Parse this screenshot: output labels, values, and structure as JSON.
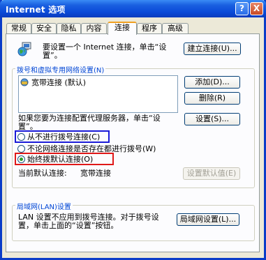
{
  "window": {
    "title": "Internet 选项",
    "help_label": "?",
    "close_label": "X"
  },
  "tabs": [
    {
      "label": "常规"
    },
    {
      "label": "安全"
    },
    {
      "label": "隐私"
    },
    {
      "label": "内容"
    },
    {
      "label": "连接",
      "active": true
    },
    {
      "label": "程序"
    },
    {
      "label": "高级"
    }
  ],
  "setup": {
    "text_line1": "要设置一个 Internet 连接，单击“设",
    "text_line2": "置”。",
    "button": "建立连接(U)..."
  },
  "dialup": {
    "group_label": "拨号和虚拟专用网络设置(N)",
    "items": [
      {
        "label": "宽带连接 (默认)"
      }
    ],
    "add_button": "添加(D)...",
    "remove_button": "删除(R)",
    "proxy_text_line1": "如果您要为连接配置代理服务器，单击“设",
    "proxy_text_line2": "置”。",
    "settings_button": "设置(S)...",
    "options": [
      {
        "label": "从不进行拨号连接(C)",
        "selected": false
      },
      {
        "label": "不论网络连接是否存在都进行拨号(W)",
        "selected": false
      },
      {
        "label": "始终拨默认连接(O)",
        "selected": true
      }
    ],
    "current_label": "当前默认连接:",
    "current_value": "宽带连接",
    "set_default_button": "设置默认值(E)"
  },
  "lan": {
    "group_label": "局域网(LAN)设置",
    "text_line1": "LAN 设置不应用到拨号连接。对于拨号设",
    "text_line2": "置，单击上面的“设置”按钮。",
    "button": "局域网设置(L)..."
  },
  "colors": {
    "title_bar": "#0a4ad8",
    "highlight_blue": "#1a1ad8",
    "highlight_red": "#e01818",
    "group_label": "#0046d5"
  }
}
